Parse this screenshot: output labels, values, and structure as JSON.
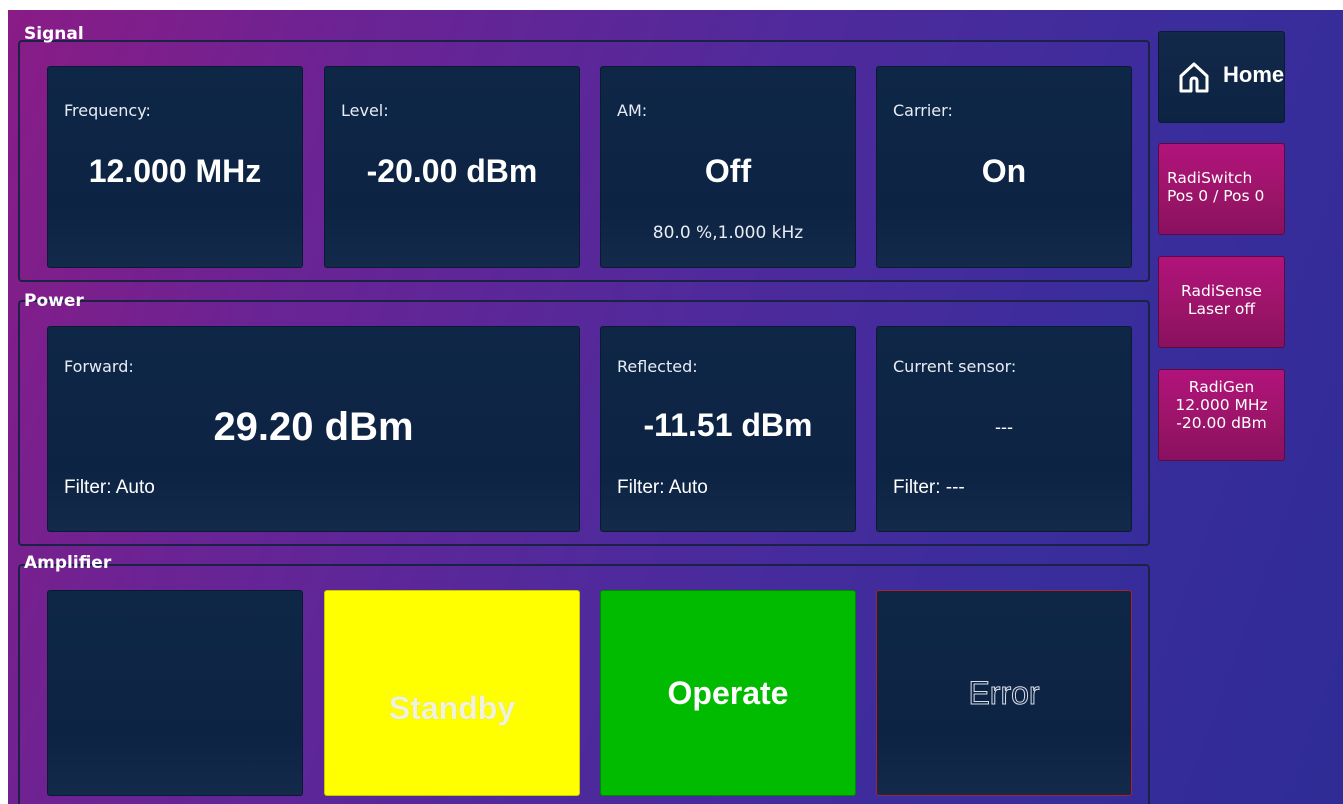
{
  "colors": {
    "panel_bg": "#0f2747",
    "standby": "#ffff00",
    "operate": "#00bb00",
    "error_border": "#aa2030",
    "side_button": "#a0136f"
  },
  "signal": {
    "title": "Signal",
    "frequency": {
      "label": "Frequency:",
      "value": "12.000 MHz"
    },
    "level": {
      "label": "Level:",
      "value": "-20.00 dBm"
    },
    "am": {
      "label": "AM:",
      "value": "Off",
      "detail": "80.0 %,1.000 kHz"
    },
    "carrier": {
      "label": "Carrier:",
      "value": "On"
    }
  },
  "power": {
    "title": "Power",
    "forward": {
      "label": "Forward:",
      "value": "29.20 dBm",
      "filter": "Filter:  Auto"
    },
    "reflected": {
      "label": "Reflected:",
      "value": "-11.51 dBm",
      "filter": "Filter:  Auto"
    },
    "current_sensor": {
      "label": "Current sensor:",
      "value": "---",
      "filter": "Filter: ---"
    }
  },
  "amplifier": {
    "title": "Amplifier",
    "standby": "Standby",
    "operate": "Operate",
    "error": "Error"
  },
  "sidebar": {
    "home_label": "Home",
    "home_icon": "home-icon",
    "radiswitch": {
      "line1": "RadiSwitch",
      "line2": "Pos 0 / Pos 0"
    },
    "radisense": {
      "line1": "RadiSense",
      "line2": "Laser off"
    },
    "radigen": {
      "line1": "RadiGen",
      "line2": "12.000 MHz",
      "line3": "-20.00 dBm"
    }
  }
}
